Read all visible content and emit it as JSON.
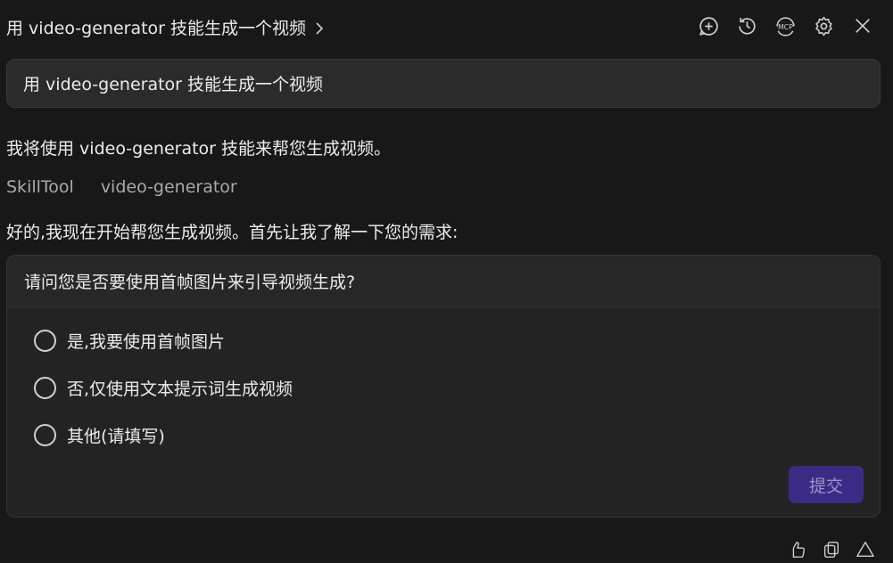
{
  "header": {
    "title": "用 video-generator 技能生成一个视频",
    "icons": [
      "add-chat-icon",
      "history-icon",
      "mcp-icon",
      "settings-icon",
      "close-icon"
    ]
  },
  "prompt": {
    "text": "用 video-generator 技能生成一个视频"
  },
  "messages": {
    "intro": "我将使用 video-generator 技能来帮您生成视频。",
    "tool_name": "SkillTool",
    "tool_arg": "video-generator",
    "followup": "好的,我现在开始帮您生成视频。首先让我了解一下您的需求:"
  },
  "question": {
    "title": "请问您是否要使用首帧图片来引导视频生成?",
    "options": [
      {
        "label": "是,我要使用首帧图片"
      },
      {
        "label": "否,仅使用文本提示词生成视频"
      },
      {
        "label": "其他(请填写)"
      }
    ],
    "submit_label": "提交"
  },
  "colors": {
    "background": "#181818",
    "accent": "#3d2a85"
  }
}
